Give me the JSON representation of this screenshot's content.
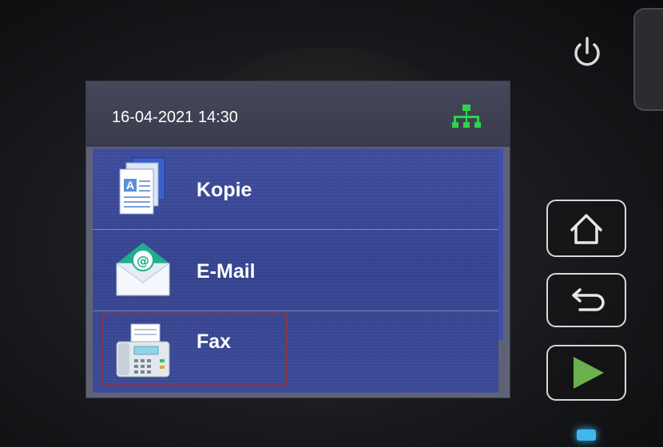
{
  "status": {
    "datetime": "16-04-2021 14:30"
  },
  "menu": {
    "items": [
      {
        "label": "Kopie",
        "icon": "copy-document-icon"
      },
      {
        "label": "E-Mail",
        "icon": "email-envelope-icon"
      },
      {
        "label": "Fax",
        "icon": "fax-machine-icon"
      }
    ],
    "selected_index": 2
  },
  "hardware_buttons": [
    {
      "name": "home",
      "icon": "home-icon"
    },
    {
      "name": "back",
      "icon": "back-arrow-icon"
    },
    {
      "name": "start",
      "icon": "play-start-icon"
    }
  ],
  "colors": {
    "network_icon": "#2ed44a",
    "start_icon": "#6ab04c",
    "led": "#3fb8f0",
    "list_bg": "#3a4894",
    "selection": "#8a3440"
  }
}
